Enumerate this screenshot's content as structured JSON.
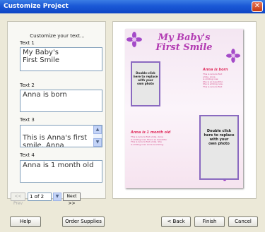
{
  "window": {
    "title": "Customize Project"
  },
  "left_panel": {
    "header": "Customize your text...",
    "fields": [
      {
        "label": "Text 1",
        "value": "My Baby's\nFirst Smile"
      },
      {
        "label": "Text 2",
        "value": "Anna is born"
      },
      {
        "label": "Text 3",
        "value": "This is Anna's first smile. Anna"
      },
      {
        "label": "Text 4",
        "value": "Anna is 1 month old"
      }
    ],
    "pager": {
      "prev": "<< Prev",
      "page": "1 of 2",
      "next": "Next >>"
    }
  },
  "preview": {
    "headline": "My Baby's\nFirst Smile",
    "caption_top": "Anna is born",
    "caption_bottom": "Anna is 1 month old",
    "photo_hint_small": "Double-click\nhere to replace\nwith your\nown photo",
    "photo_hint_large": "Double click\nhere to replace\nwith your\nown photo",
    "body_top": "This is Anna's first\nsmile. Anna\nis smiling now.\nShe is so beautiful.\nShe is smiling now.\nThis is Anna's first",
    "body_bottom": "This is Anna's first smile. Anna\nis smiling now. She is so beautiful.\nThis is Anna's first smile. She\nis smiling now. Anna is smiling."
  },
  "buttons": {
    "help": "Help",
    "order_supplies": "Order Supplies",
    "back": "< Back",
    "finish": "Finish",
    "cancel": "Cancel"
  },
  "colors": {
    "titlebar": "#1a58d6",
    "headline": "#b23bb2",
    "caption": "#e03060"
  },
  "icons": {
    "close": "close-icon",
    "scroll_up": "chevron-up-icon",
    "scroll_down": "chevron-down-icon",
    "pager_dropdown": "chevron-down-icon",
    "flower": "flower-icon"
  }
}
